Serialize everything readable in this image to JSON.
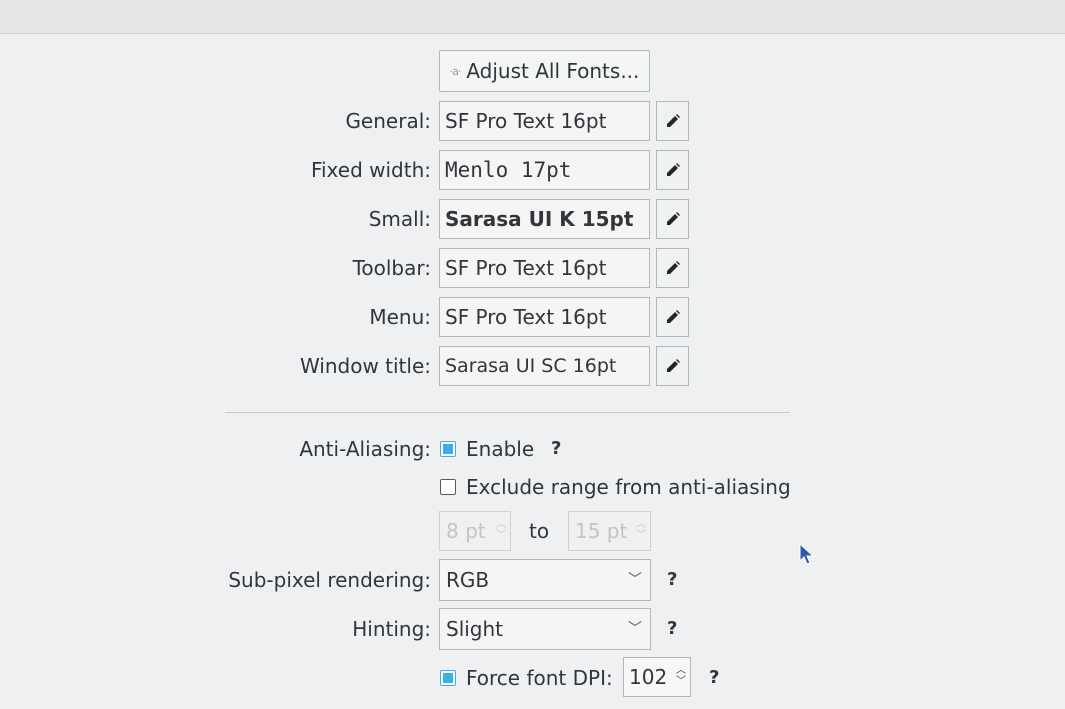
{
  "adjust_all_button": "Adjust All Fonts...",
  "font_rows": [
    {
      "label": "General:",
      "value": "SF Pro Text 16pt"
    },
    {
      "label": "Fixed width:",
      "value": "Menlo 17pt"
    },
    {
      "label": "Small:",
      "value": "Sarasa UI K 15pt"
    },
    {
      "label": "Toolbar:",
      "value": "SF Pro Text 16pt"
    },
    {
      "label": "Menu:",
      "value": "SF Pro Text 16pt"
    },
    {
      "label": "Window title:",
      "value": "Sarasa UI SC 16pt"
    }
  ],
  "anti_aliasing": {
    "label": "Anti-Aliasing:",
    "enable_label": "Enable",
    "enable_checked": true,
    "help": "?",
    "exclude_label": "Exclude range from anti-aliasing",
    "exclude_checked": false,
    "range_from": "8 pt",
    "range_to_label": "to",
    "range_to": "15 pt"
  },
  "subpixel": {
    "label": "Sub-pixel rendering:",
    "value": "RGB",
    "help": "?"
  },
  "hinting": {
    "label": "Hinting:",
    "value": "Slight",
    "help": "?"
  },
  "force_dpi": {
    "label": "Force font DPI:",
    "checked": true,
    "value": "102",
    "help": "?"
  },
  "colors": {
    "accent": "#3daee9",
    "background": "#eff0f1",
    "text": "#31363b"
  }
}
